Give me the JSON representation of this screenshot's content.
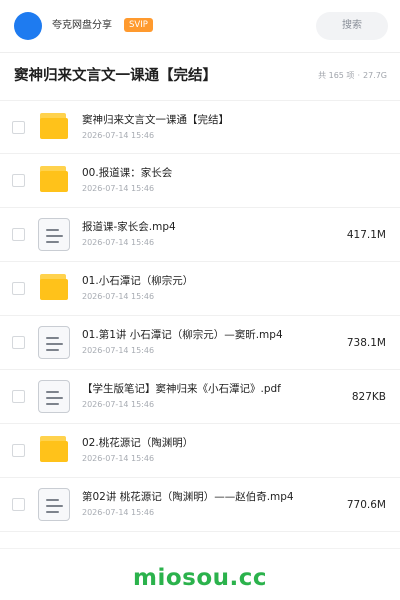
{
  "header": {
    "share_name": "夸克网盘分享",
    "badge": "SVIP",
    "search_label": "搜索"
  },
  "title_row": {
    "title": "窦神归来文言文一课通【完结】",
    "item_count": "共 165 项",
    "separator": "·",
    "total_size": "27.7G"
  },
  "items": [
    {
      "type": "folder",
      "icon": "folder-icon",
      "name": "窦神归来文言文一课通【完结】",
      "date": "2026-07-14 15:46",
      "size": ""
    },
    {
      "type": "folder",
      "icon": "folder-icon",
      "name": "00.报道课：家长会",
      "date": "2026-07-14 15:46",
      "size": ""
    },
    {
      "type": "file",
      "icon": "file-icon",
      "name": "报道课-家长会.mp4",
      "date": "2026-07-14 15:46",
      "size": "417.1M"
    },
    {
      "type": "folder",
      "icon": "folder-icon",
      "name": "01.小石潭记（柳宗元）",
      "date": "2026-07-14 15:46",
      "size": ""
    },
    {
      "type": "file",
      "icon": "file-icon",
      "name": "01.第1讲 小石潭记（柳宗元）—窦昕.mp4",
      "date": "2026-07-14 15:46",
      "size": "738.1M"
    },
    {
      "type": "file",
      "icon": "file-icon",
      "name": "【学生版笔记】窦神归来《小石潭记》.pdf",
      "date": "2026-07-14 15:46",
      "size": "827KB"
    },
    {
      "type": "folder",
      "icon": "folder-icon",
      "name": "02.桃花源记（陶渊明）",
      "date": "2026-07-14 15:46",
      "size": ""
    },
    {
      "type": "file",
      "icon": "file-icon",
      "name": "第02讲 桃花源记（陶渊明）——赵伯奇.mp4",
      "date": "2026-07-14 15:46",
      "size": "770.6M"
    }
  ],
  "footer": {
    "watermark": "miosou.cc"
  },
  "colors": {
    "accent_blue": "#1e7bf0",
    "svip_orange": "#ff9a2e",
    "folder_yellow": "#ffc21a",
    "watermark_green": "#2bb24c"
  }
}
